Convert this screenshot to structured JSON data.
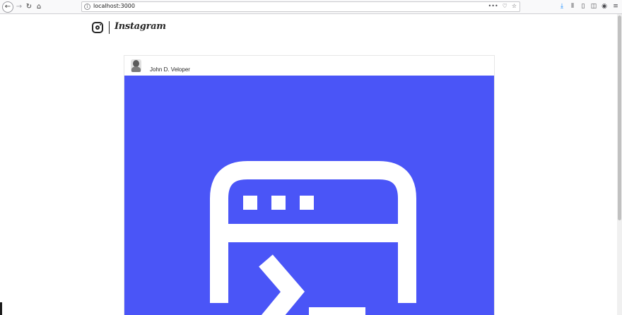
{
  "browser": {
    "url": "localhost:3000",
    "nav": {
      "back_icon": "←",
      "forward_icon": "→",
      "reload_icon": "↻",
      "home_icon": "⌂"
    },
    "url_actions": [
      "•••",
      "♡",
      "☆"
    ],
    "toolbar_icons": {
      "download": "⤓",
      "library": "⫴",
      "sidebar": "▯",
      "screenshot": "◫",
      "extensions": "◉",
      "menu": "≡"
    }
  },
  "app": {
    "wordmark": "Instagram"
  },
  "post": {
    "username": "John D. Veloper",
    "image_color": "#4a55f7",
    "image_icon": "terminal-window-icon"
  }
}
